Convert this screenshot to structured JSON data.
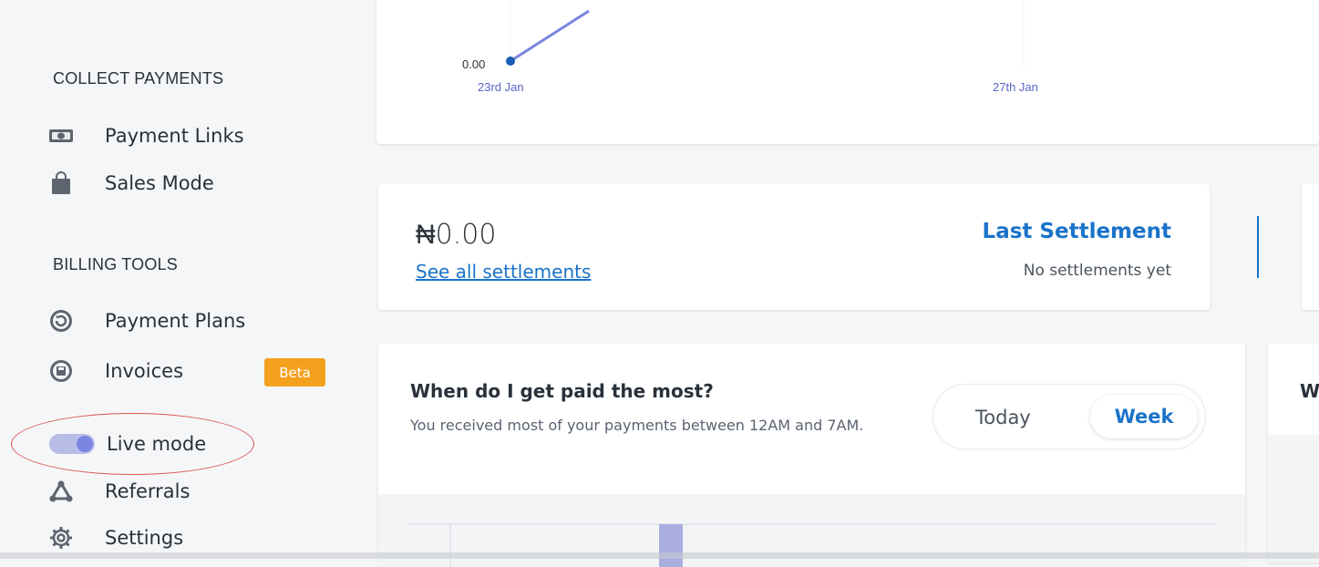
{
  "sidebar": {
    "collect_title": "COLLECT PAYMENTS",
    "collect_items": [
      {
        "label": "Payment Links",
        "icon": "money-icon"
      },
      {
        "label": "Sales Mode",
        "icon": "shopping-bag-icon"
      }
    ],
    "billing_title": "BILLING TOOLS",
    "billing_items": [
      {
        "label": "Payment Plans",
        "icon": "refresh-circle-icon"
      },
      {
        "label": "Invoices",
        "icon": "invoice-icon",
        "badge": "Beta"
      }
    ],
    "live_mode_label": "Live mode",
    "referrals_label": "Referrals",
    "settings_label": "Settings"
  },
  "top_chart": {
    "y_label": "0.00",
    "x_labels": [
      "23rd Jan",
      "27th Jan"
    ],
    "line_color": "#7b84e0"
  },
  "settlement": {
    "amount": "₦0.00",
    "see_all": "See all settlements",
    "last_title": "Last Settlement",
    "no_settlements": "No settlements yet"
  },
  "paid_most": {
    "title": "When do I get paid the most?",
    "subtitle": "You received most of your payments between 12AM and 7AM.",
    "tab_today": "Today",
    "tab_week": "Week",
    "selected_tab": "Week"
  },
  "peek_card": {
    "letter": "W"
  },
  "colors": {
    "accent": "#1a73c9",
    "badge": "#f4a11e",
    "toggle": "#7b84e0"
  }
}
